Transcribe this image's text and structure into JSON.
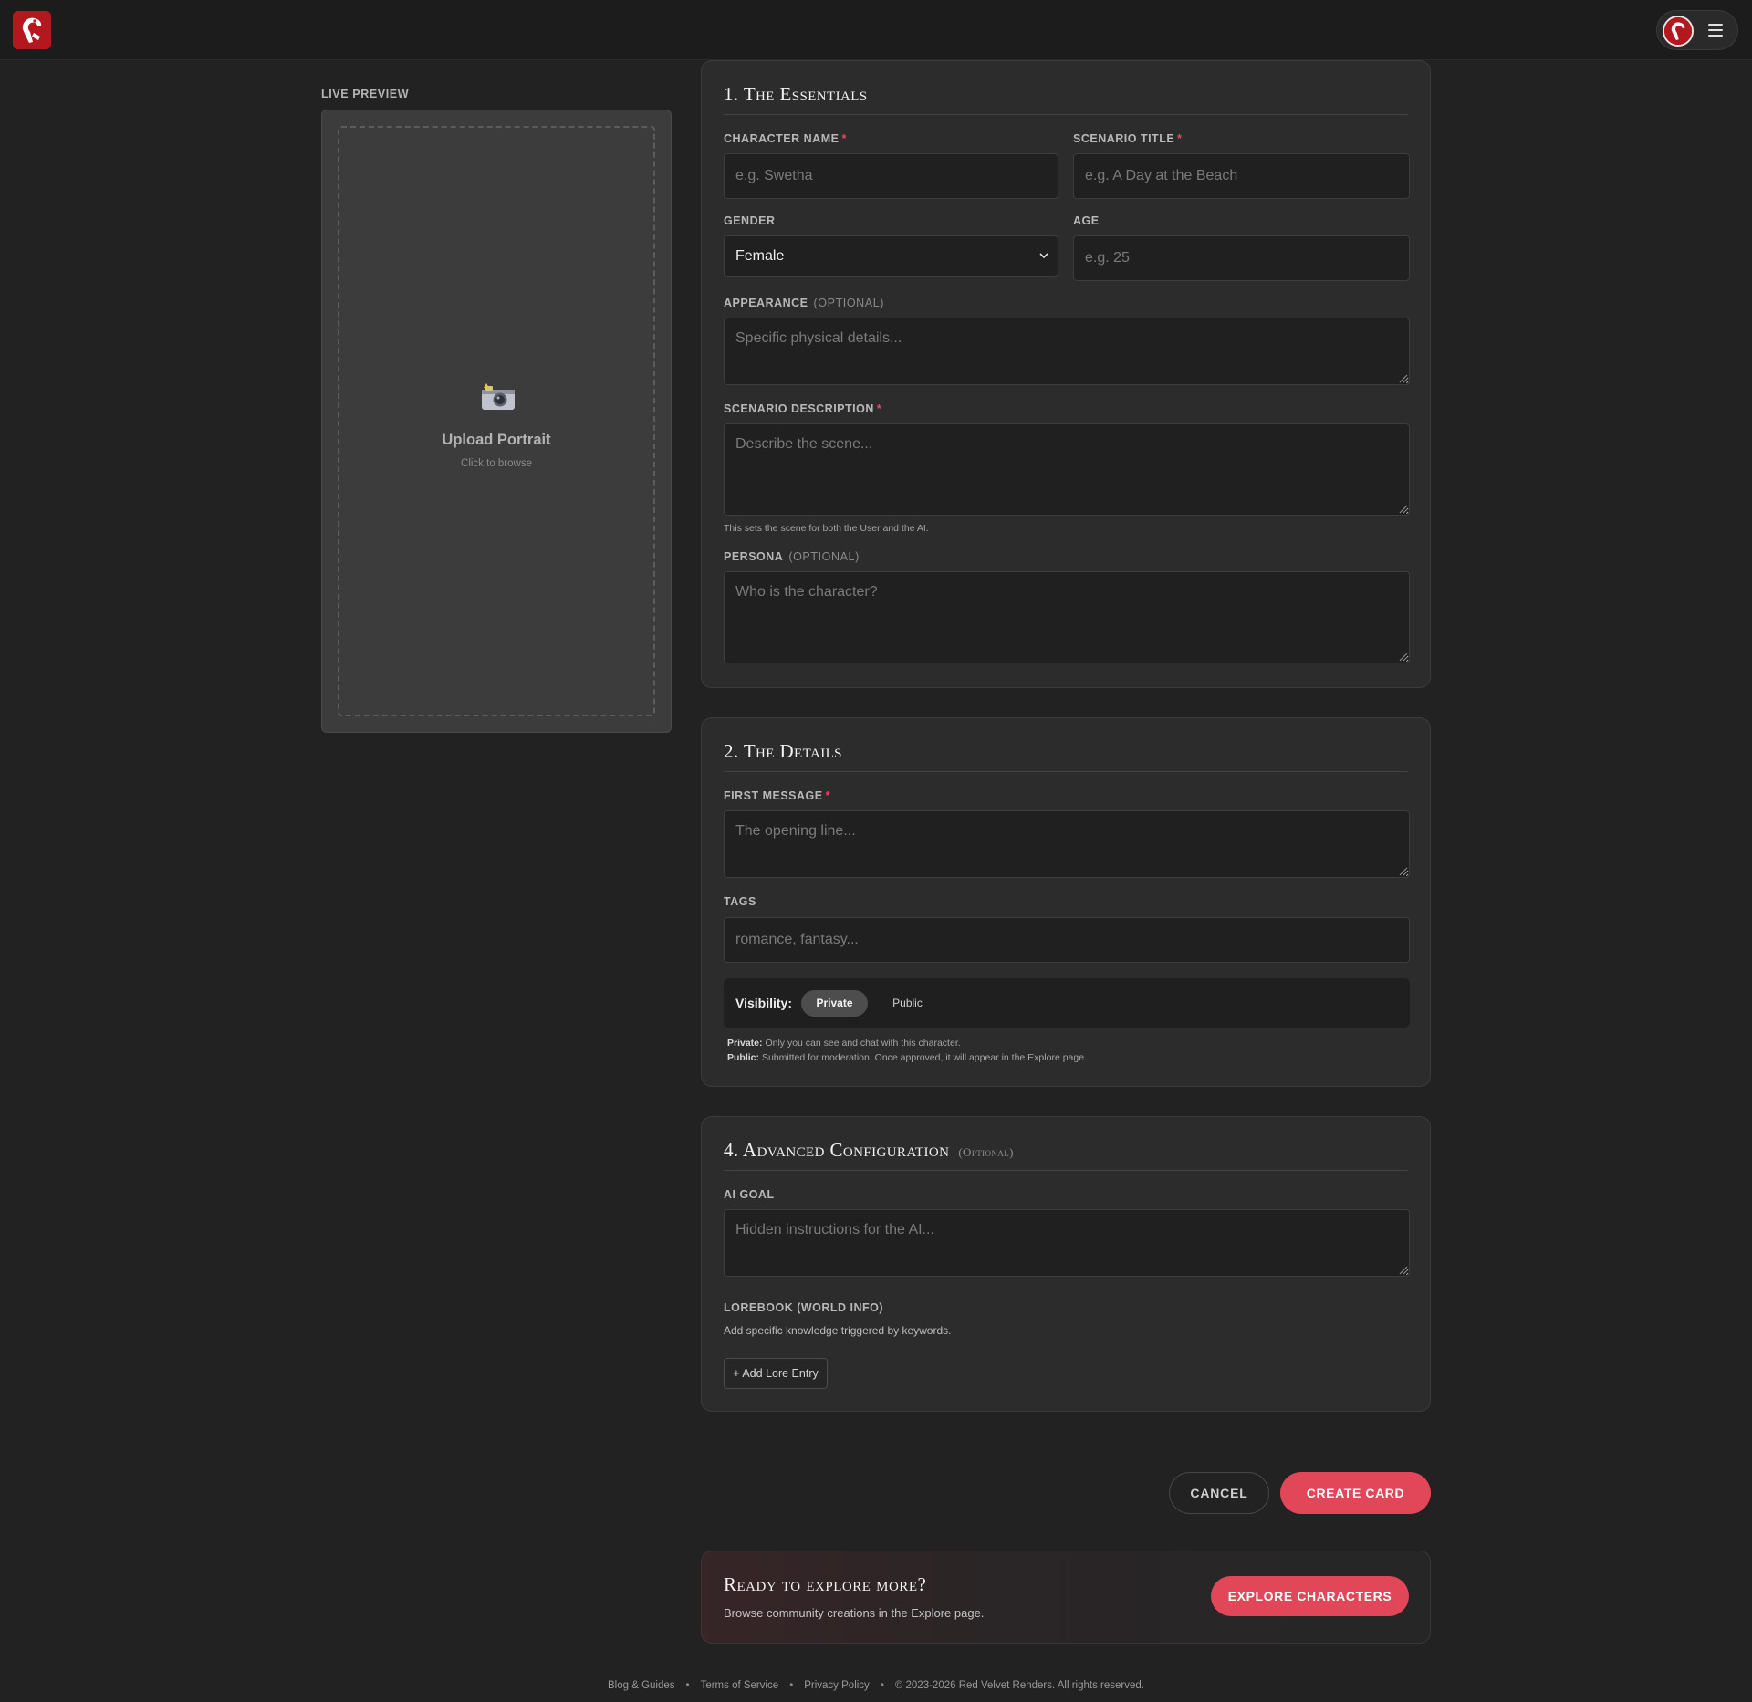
{
  "header": {
    "logo_alt": "Red Velvet Renders logo",
    "menu_icon": "hamburger-menu-icon"
  },
  "preview": {
    "label": "LIVE PREVIEW",
    "upload_title": "Upload Portrait",
    "upload_sub": "Click to browse",
    "icon": "camera-icon"
  },
  "essentials": {
    "title": "1. The Essentials",
    "character_name": {
      "label": "CHARACTER NAME",
      "required": "*",
      "placeholder": "e.g. Swetha",
      "value": ""
    },
    "scenario_title": {
      "label": "SCENARIO TITLE",
      "required": "*",
      "placeholder": "e.g. A Day at the Beach",
      "value": ""
    },
    "gender": {
      "label": "GENDER",
      "selected": "Female"
    },
    "age": {
      "label": "AGE",
      "placeholder": "e.g. 25",
      "value": ""
    },
    "appearance": {
      "label": "APPEARANCE",
      "optional": "(OPTIONAL)",
      "placeholder": "Specific physical details..."
    },
    "scenario_description": {
      "label": "SCENARIO DESCRIPTION",
      "required": "*",
      "placeholder": "Describe the scene...",
      "helper": "This sets the scene for both the User and the AI."
    },
    "persona": {
      "label": "PERSONA",
      "optional": "(OPTIONAL)",
      "placeholder": "Who is the character?"
    }
  },
  "details": {
    "title": "2. The Details",
    "first_message": {
      "label": "FIRST MESSAGE",
      "required": "*",
      "placeholder": "The opening line..."
    },
    "tags": {
      "label": "TAGS",
      "placeholder": "romance, fantasy..."
    },
    "visibility": {
      "label": "Visibility:",
      "private": "Private",
      "public": "Public",
      "selected": "Private",
      "private_note_label": "Private:",
      "private_note": "Only you can see and chat with this character.",
      "public_note_label": "Public:",
      "public_note": "Submitted for moderation. Once approved, it will appear in the Explore page."
    }
  },
  "advanced": {
    "title": "4. Advanced Configuration",
    "optional": "(Optional)",
    "ai_goal": {
      "label": "AI GOAL",
      "placeholder": "Hidden instructions for the AI..."
    },
    "lorebook": {
      "label": "LOREBOOK (WORLD INFO)",
      "description": "Add specific knowledge triggered by keywords.",
      "button": "+ Add Lore Entry"
    }
  },
  "actions": {
    "cancel": "CANCEL",
    "create": "CREATE CARD"
  },
  "explore": {
    "title": "Ready to explore more?",
    "subtitle": "Browse community creations in the Explore page.",
    "button": "EXPLORE CHARACTERS"
  },
  "footer": {
    "links": [
      "Blog & Guides",
      "Terms of Service",
      "Privacy Policy"
    ],
    "separator": "•",
    "copyright": "© 2023-2026 Red Velvet Renders. All rights reserved."
  },
  "colors": {
    "accent": "#e24659",
    "background": "#222222",
    "card": "#2c2c2c",
    "logo_red": "#b3181f"
  }
}
